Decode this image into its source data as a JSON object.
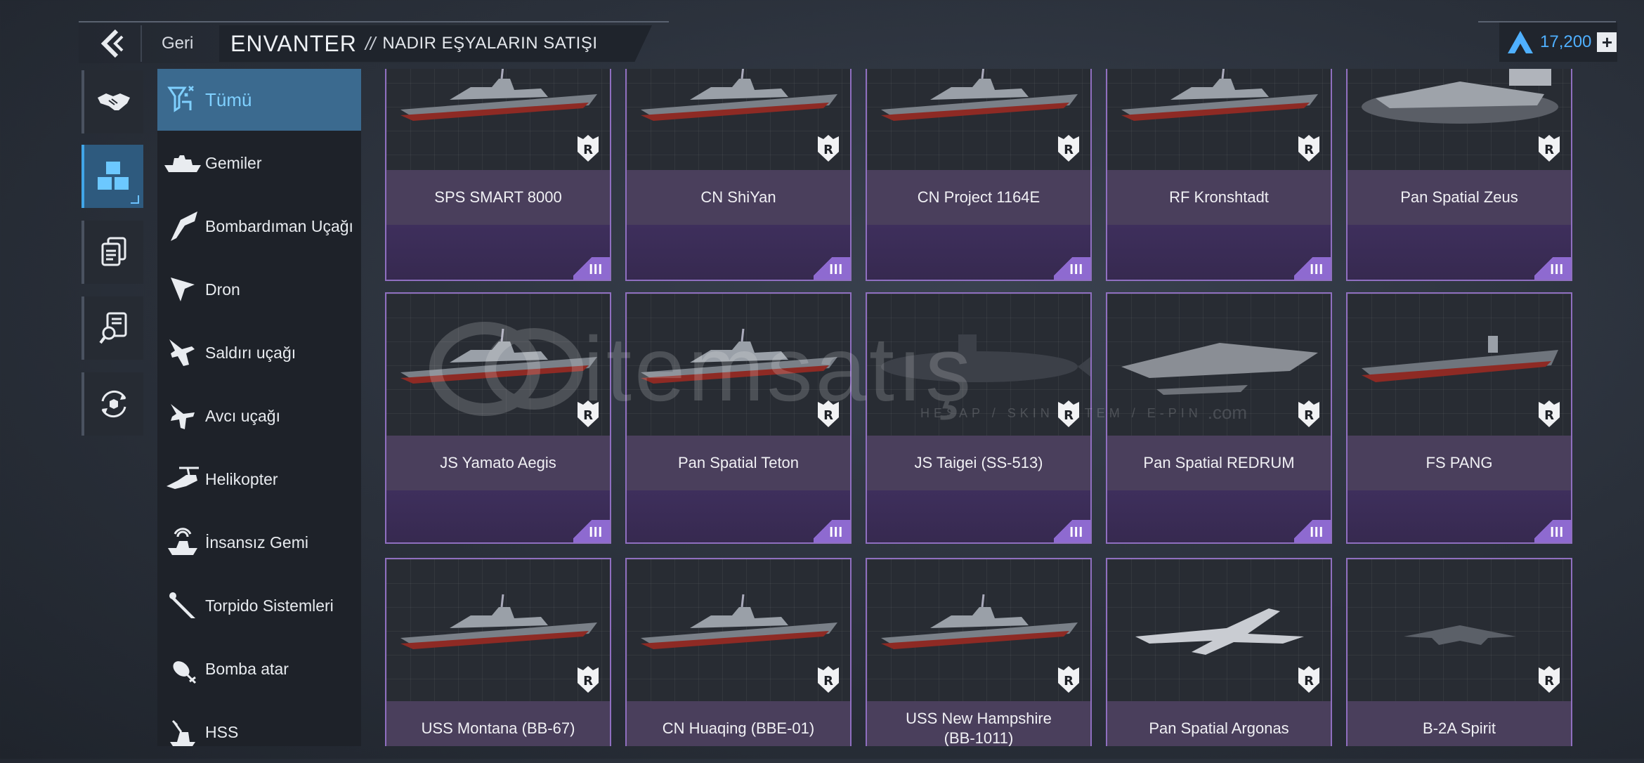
{
  "header": {
    "back_label": "Geri",
    "title": "ENVANTER",
    "separator": "//",
    "subtitle": "NADIR EŞYALARIN SATIŞI"
  },
  "currency": {
    "value": "17,200",
    "icon": "rank-arrow-icon",
    "color": "#4fb0ff",
    "plus": "+"
  },
  "side_icons": [
    "handshake-icon",
    "cubes-icon",
    "documents-icon",
    "search-document-icon",
    "refresh-box-icon"
  ],
  "categories": [
    {
      "label": "Tümü",
      "icon": "all-filter-icon",
      "active": true
    },
    {
      "label": "Gemiler",
      "icon": "ship-icon"
    },
    {
      "label": "Bombardıman Uçağı",
      "icon": "bomber-icon"
    },
    {
      "label": "Dron",
      "icon": "drone-icon"
    },
    {
      "label": "Saldırı uçağı",
      "icon": "attack-jet-icon"
    },
    {
      "label": "Avcı uçağı",
      "icon": "fighter-jet-icon"
    },
    {
      "label": "Helikopter",
      "icon": "helicopter-icon"
    },
    {
      "label": "İnsansız Gemi",
      "icon": "unmanned-ship-icon"
    },
    {
      "label": "Torpido Sistemleri",
      "icon": "torpedo-icon"
    },
    {
      "label": "Bomba atar",
      "icon": "bomb-launcher-icon"
    },
    {
      "label": "HSS",
      "icon": "hss-icon"
    }
  ],
  "items": [
    {
      "name": "SPS SMART 8000",
      "tier": "III",
      "badge": "R",
      "kind": "ship"
    },
    {
      "name": "CN ShiYan",
      "tier": "III",
      "badge": "R",
      "kind": "ship"
    },
    {
      "name": "CN Project 1164E",
      "tier": "III",
      "badge": "R",
      "kind": "ship"
    },
    {
      "name": "RF Kronshtadt",
      "tier": "III",
      "badge": "R",
      "kind": "ship"
    },
    {
      "name": "Pan Spatial Zeus",
      "tier": "III",
      "badge": "R",
      "kind": "hover"
    },
    {
      "name": "JS Yamato Aegis",
      "tier": "III",
      "badge": "R",
      "kind": "ship"
    },
    {
      "name": "Pan Spatial Teton",
      "tier": "III",
      "badge": "R",
      "kind": "ship"
    },
    {
      "name": "JS Taigei (SS-513)",
      "tier": "III",
      "badge": "R",
      "kind": "sub"
    },
    {
      "name": "Pan Spatial REDRUM",
      "tier": "III",
      "badge": "R",
      "kind": "stealth"
    },
    {
      "name": "FS PANG",
      "tier": "III",
      "badge": "R",
      "kind": "carrier"
    },
    {
      "name": "USS Montana (BB-67)",
      "tier": "",
      "badge": "R",
      "kind": "ship"
    },
    {
      "name": "CN Huaqing (BBE-01)",
      "tier": "",
      "badge": "R",
      "kind": "ship"
    },
    {
      "name": "USS New Hampshire\n(BB-1011)",
      "tier": "",
      "badge": "R",
      "kind": "ship"
    },
    {
      "name": "Pan Spatial Argonas",
      "tier": "",
      "badge": "R",
      "kind": "drone"
    },
    {
      "name": "B-2A Spirit",
      "tier": "",
      "badge": "R",
      "kind": "bomber"
    }
  ],
  "watermark": {
    "text": "itemsatış",
    "sub": "HESAP / SKIN / ITEM / E-PIN",
    "domain": ".com"
  }
}
